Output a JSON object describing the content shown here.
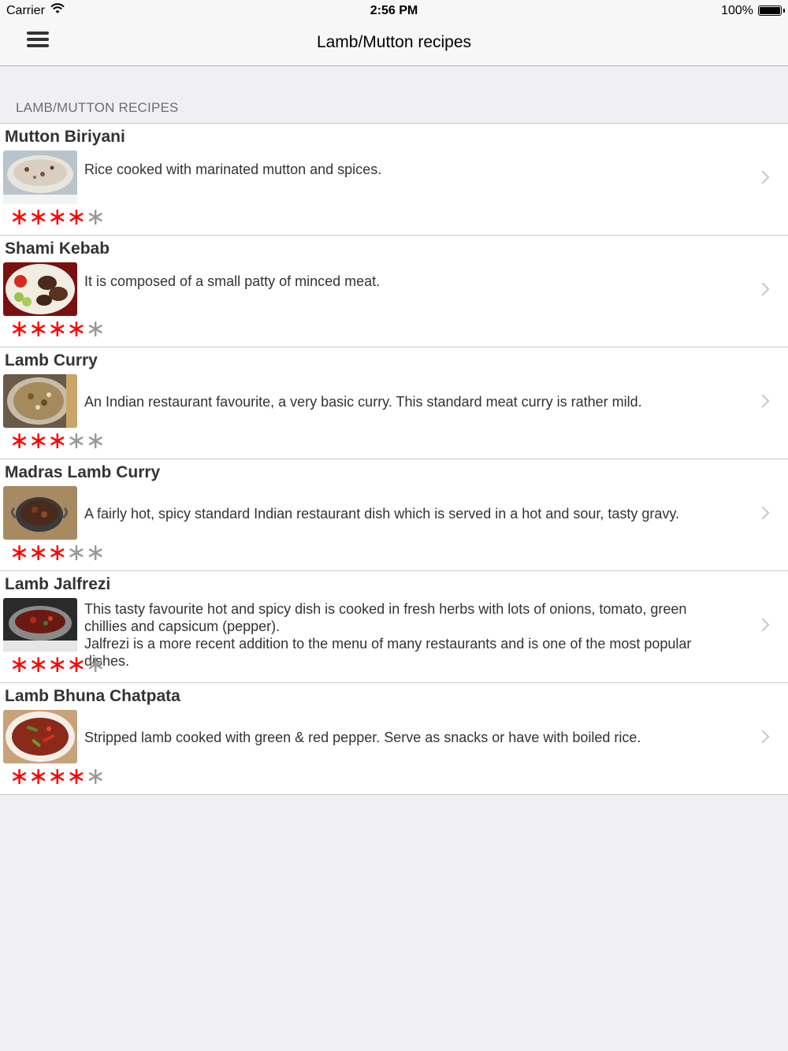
{
  "status": {
    "carrier": "Carrier",
    "time": "2:56 PM",
    "battery": "100%"
  },
  "nav": {
    "title": "Lamb/Mutton recipes",
    "menu_icon": "hamburger-menu-icon"
  },
  "section": {
    "header": "LAMB/MUTTON RECIPES"
  },
  "recipes": [
    {
      "name": "Mutton Biriyani",
      "description": "Rice cooked with marinated mutton and spices.",
      "rating": 4,
      "max_rating": 5
    },
    {
      "name": "Shami Kebab",
      "description": "It is composed of a small patty of minced meat.",
      "rating": 4,
      "max_rating": 5
    },
    {
      "name": "Lamb Curry",
      "description": "An Indian restaurant favourite, a very basic curry. This standard meat curry is rather mild.",
      "rating": 3,
      "max_rating": 5
    },
    {
      "name": "Madras Lamb Curry",
      "description": "A fairly hot, spicy standard Indian restaurant dish which is served in a hot and sour, tasty gravy.",
      "rating": 3,
      "max_rating": 5
    },
    {
      "name": "Lamb Jalfrezi",
      "description": "This tasty favourite hot and spicy dish is cooked in fresh herbs with lots of onions, tomato, green chillies and capsicum (pepper).\nJalfrezi is a more recent addition to the menu of many restaurants and is one of the most popular dishes.",
      "rating": 4,
      "max_rating": 5
    },
    {
      "name": "Lamb Bhuna Chatpata",
      "description": "Stripped lamb cooked with green & red pepper. Serve as snacks or have with boiled rice.",
      "rating": 4,
      "max_rating": 5
    }
  ],
  "colors": {
    "star_on": "#ff0000",
    "star_off": "#999999",
    "background": "#efeff4"
  }
}
